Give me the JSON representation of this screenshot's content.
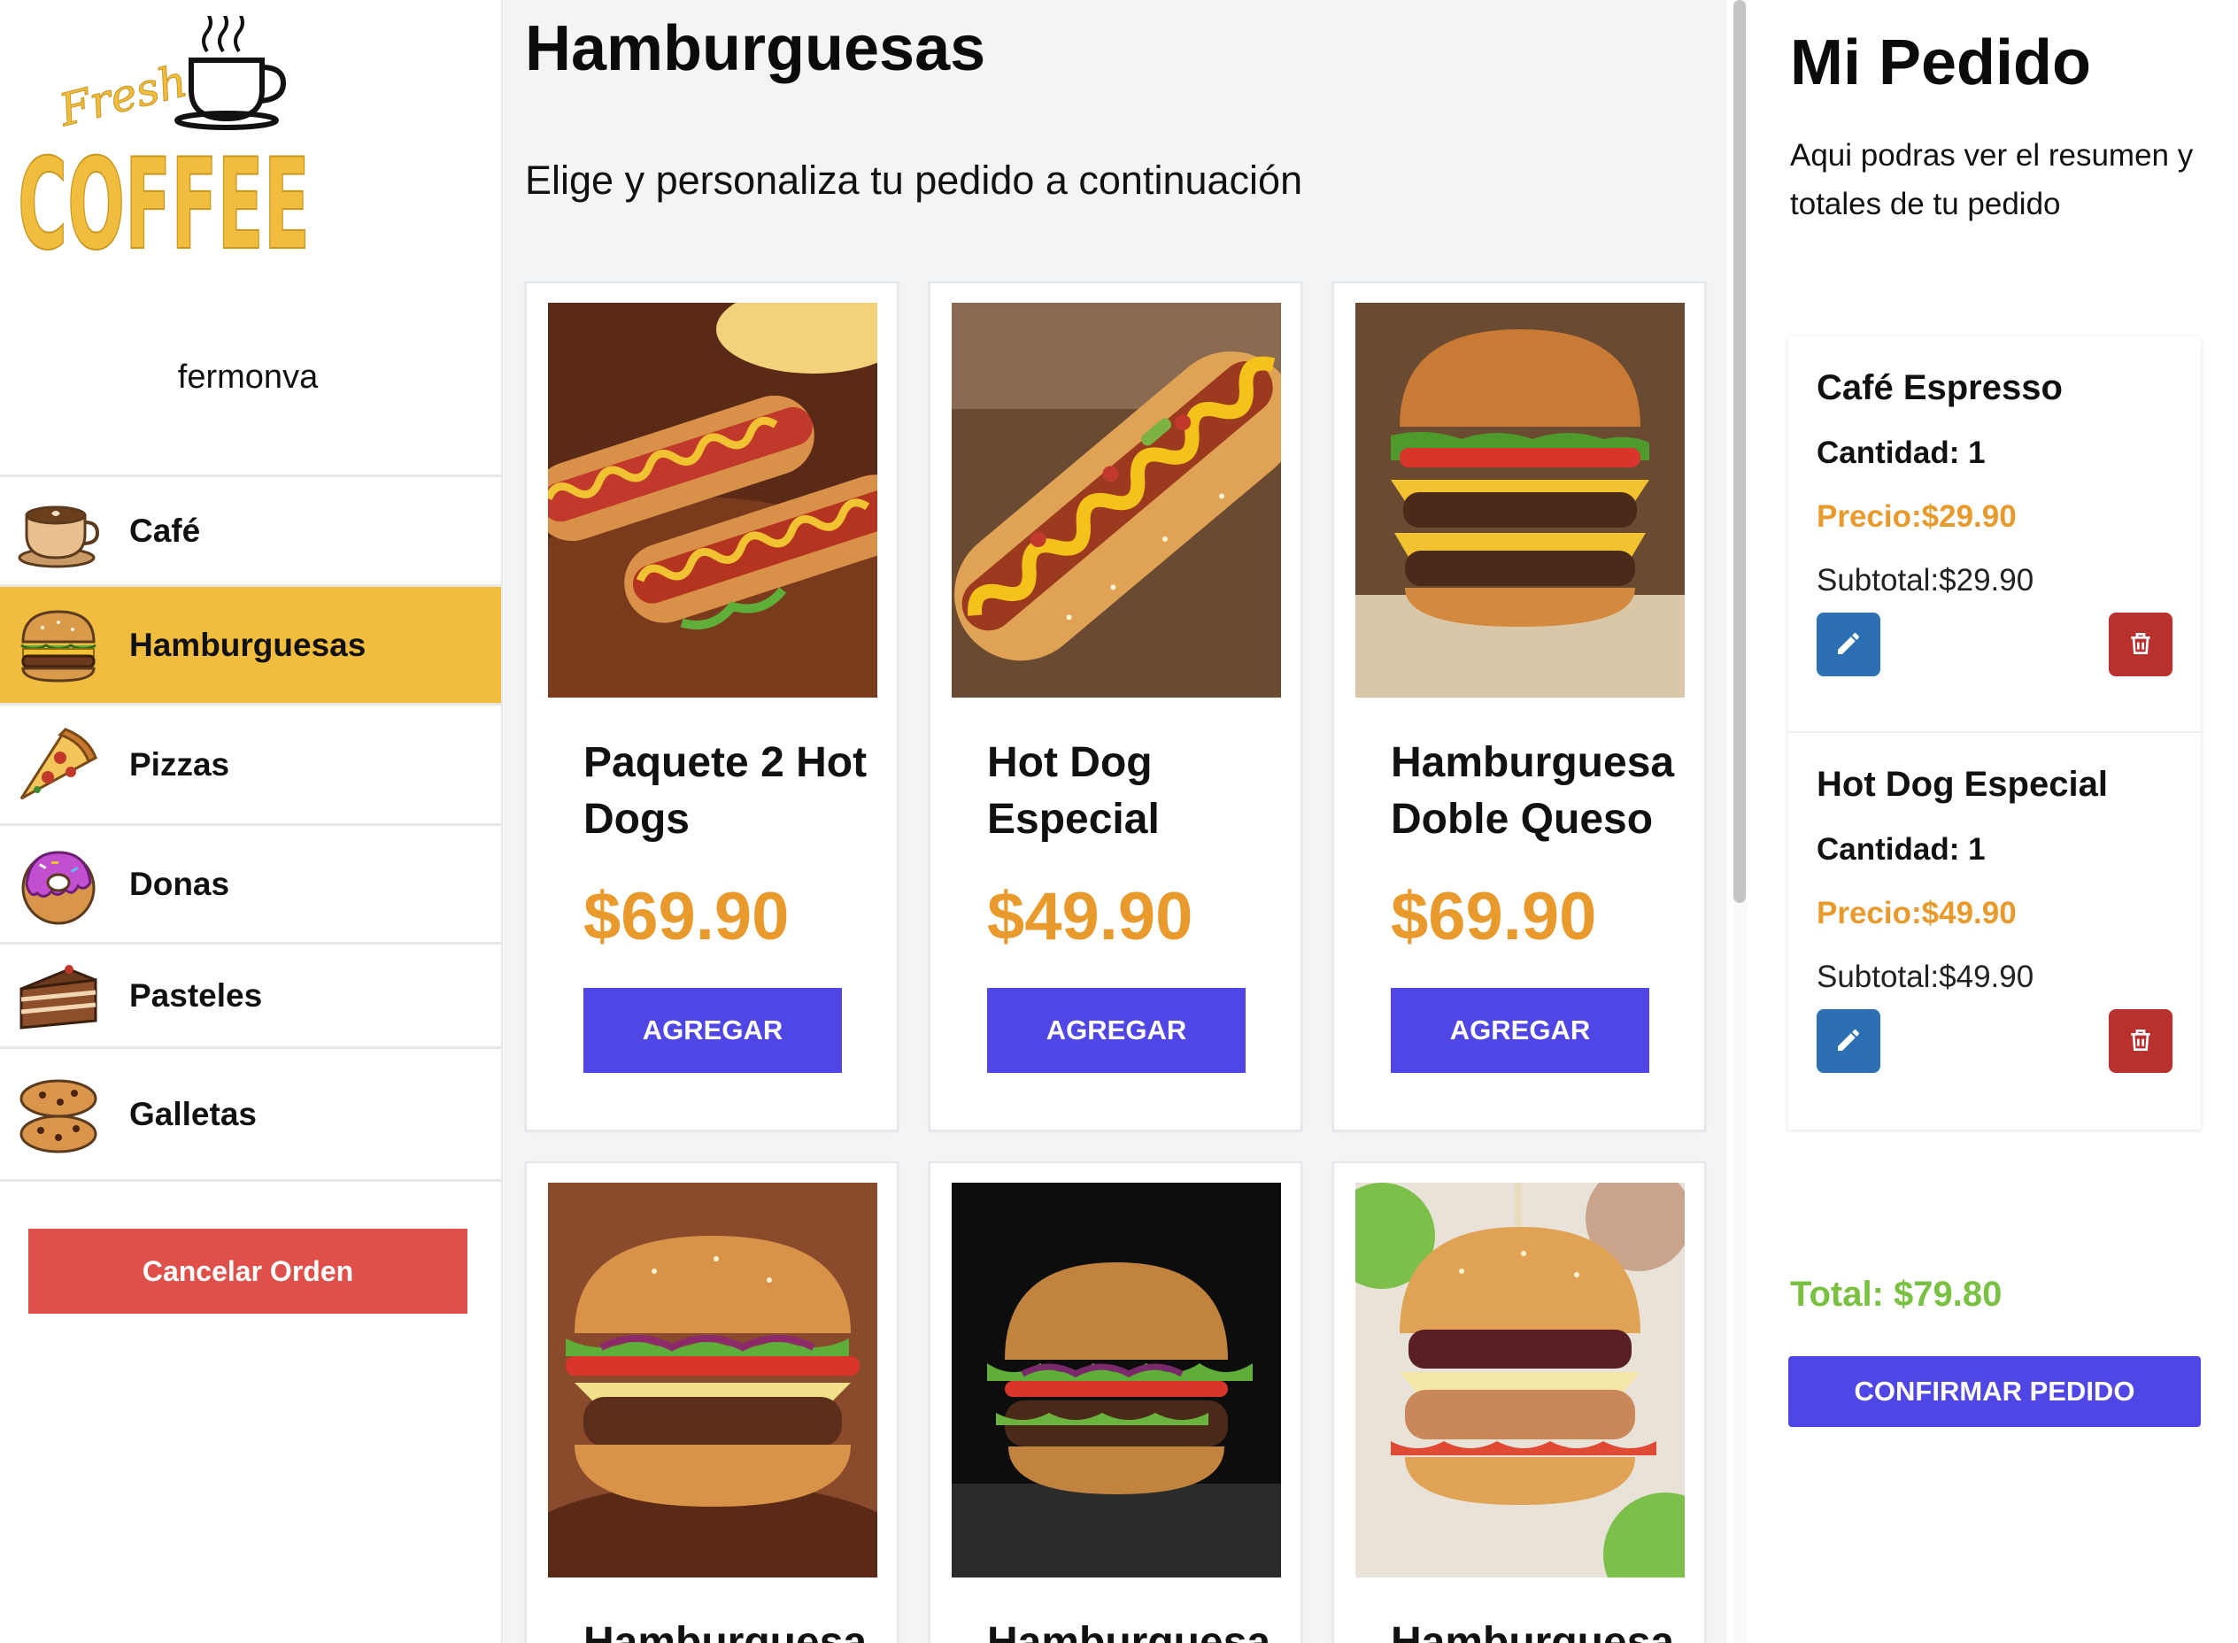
{
  "brand": {
    "logo_top": "Fresh",
    "logo_main": "COFFEE"
  },
  "user": {
    "name": "fermonva"
  },
  "categories": [
    {
      "label": "Café",
      "icon": "coffee-cup-icon"
    },
    {
      "label": "Hamburguesas",
      "icon": "burger-icon",
      "active": true
    },
    {
      "label": "Pizzas",
      "icon": "pizza-icon"
    },
    {
      "label": "Donas",
      "icon": "donut-icon"
    },
    {
      "label": "Pasteles",
      "icon": "cake-icon"
    },
    {
      "label": "Galletas",
      "icon": "cookie-icon"
    }
  ],
  "sidebar": {
    "cancel_label": "Cancelar Orden"
  },
  "main": {
    "title": "Hamburguesas",
    "subtitle": "Elige y personaliza tu pedido a continuación",
    "add_label": "AGREGAR",
    "products": [
      {
        "name": "Paquete 2 Hot Dogs",
        "price": "$69.90",
        "image": "hot-dogs-photo"
      },
      {
        "name": "Hot Dog Especial",
        "price": "$49.90",
        "image": "hot-dog-photo"
      },
      {
        "name": "Hamburguesa Doble Queso",
        "price": "$69.90",
        "image": "double-cheeseburger-photo"
      },
      {
        "name": "Hamburguesa",
        "price": "",
        "image": "burger-photo"
      },
      {
        "name": "Hamburguesa",
        "price": "",
        "image": "burger-dark-photo"
      },
      {
        "name": "Hamburguesa",
        "price": "",
        "image": "chicken-burger-photo"
      }
    ]
  },
  "order": {
    "title": "Mi Pedido",
    "description": "Aqui podras ver el resumen y totales de tu pedido",
    "items": [
      {
        "name": "Café Espresso",
        "qty": "Cantidad: 1",
        "price": "Precio:$29.90",
        "subtotal": "Subtotal:$29.90"
      },
      {
        "name": "Hot Dog Especial",
        "qty": "Cantidad: 1",
        "price": "Precio:$49.90",
        "subtotal": "Subtotal:$49.90"
      }
    ],
    "total": "Total: $79.80",
    "confirm_label": "CONFIRMAR PEDIDO"
  },
  "colors": {
    "accent": "#f1bd3f",
    "primary": "#4f46e5",
    "price": "#e89a2d",
    "danger": "#e0504a",
    "total": "#7ac143",
    "edit": "#2c6fb3",
    "delete": "#b8312f"
  }
}
